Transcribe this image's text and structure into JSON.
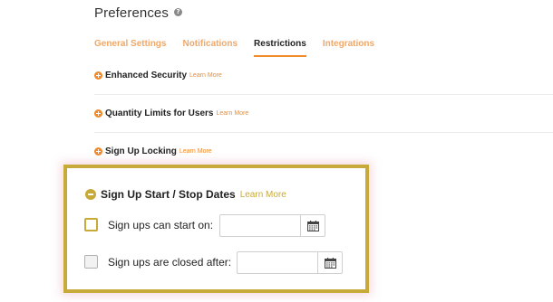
{
  "header": {
    "title": "Preferences",
    "help_icon": "question-circle-icon"
  },
  "tabs": [
    {
      "label": "General Settings",
      "active": false
    },
    {
      "label": "Notifications",
      "active": false
    },
    {
      "label": "Restrictions",
      "active": true
    },
    {
      "label": "Integrations",
      "active": false
    }
  ],
  "sections": [
    {
      "label": "Enhanced Security",
      "learn_more": "Learn More",
      "icon": "plus-circle-icon"
    },
    {
      "label": "Quantity Limits for Users",
      "learn_more": "Learn More",
      "icon": "plus-circle-icon"
    },
    {
      "label": "Sign Up Locking",
      "learn_more": "Learn More",
      "icon": "plus-circle-icon"
    }
  ],
  "expanded_section": {
    "title": "Sign Up Start / Stop Dates",
    "learn_more": "Learn More",
    "icon": "minus-circle-icon",
    "options": [
      {
        "label": "Sign ups can start on:",
        "value": "",
        "checked": false,
        "calendar_icon": "calendar-icon"
      },
      {
        "label": "Sign ups are closed after:",
        "value": "",
        "checked": false,
        "calendar_icon": "calendar-icon"
      }
    ]
  },
  "colors": {
    "accent_orange": "#f08a2a",
    "tab_inactive": "#f0a868",
    "highlight_gold": "#c8aa3a"
  }
}
